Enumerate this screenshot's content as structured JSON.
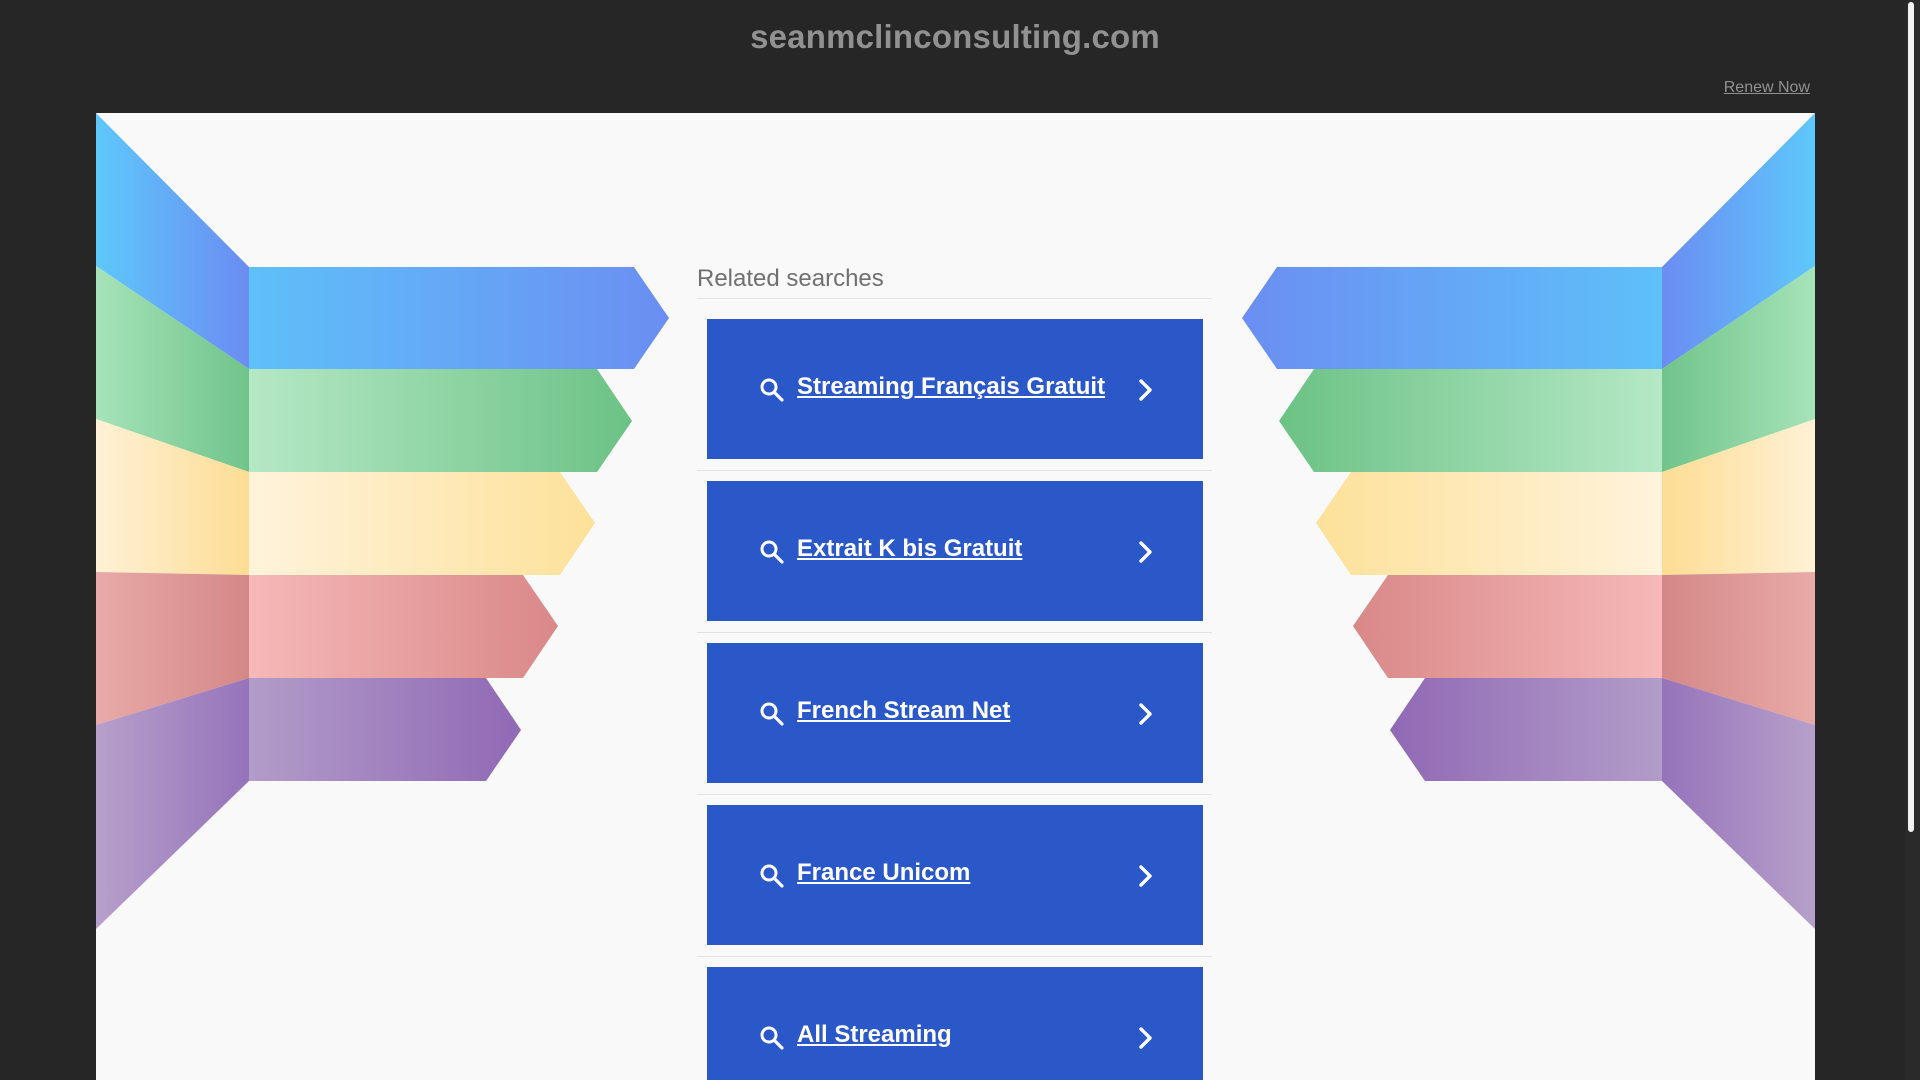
{
  "header": {
    "site_title": "seanmclinconsulting.com",
    "renew_label": "Renew Now"
  },
  "related": {
    "title": "Related searches",
    "items": [
      {
        "label": "Streaming Français Gratuit",
        "icon": "search-icon",
        "trailing_icon": "chevron-right-icon"
      },
      {
        "label": "Extrait K bis Gratuit",
        "icon": "search-icon",
        "trailing_icon": "chevron-right-icon"
      },
      {
        "label": "French Stream Net",
        "icon": "search-icon",
        "trailing_icon": "chevron-right-icon"
      },
      {
        "label": "France Unicom",
        "icon": "search-icon",
        "trailing_icon": "chevron-right-icon"
      },
      {
        "label": "All Streaming",
        "icon": "search-icon",
        "trailing_icon": "chevron-right-icon"
      }
    ]
  },
  "colors": {
    "page_background": "#262626",
    "content_background": "#f9f9f9",
    "button_background": "#2b58c8",
    "band_blue": "#5a8cf2",
    "band_green": "#79cc8f",
    "band_yellow": "#fde3a3",
    "band_red": "#e59ca1",
    "band_purple": "#a68cc8"
  }
}
